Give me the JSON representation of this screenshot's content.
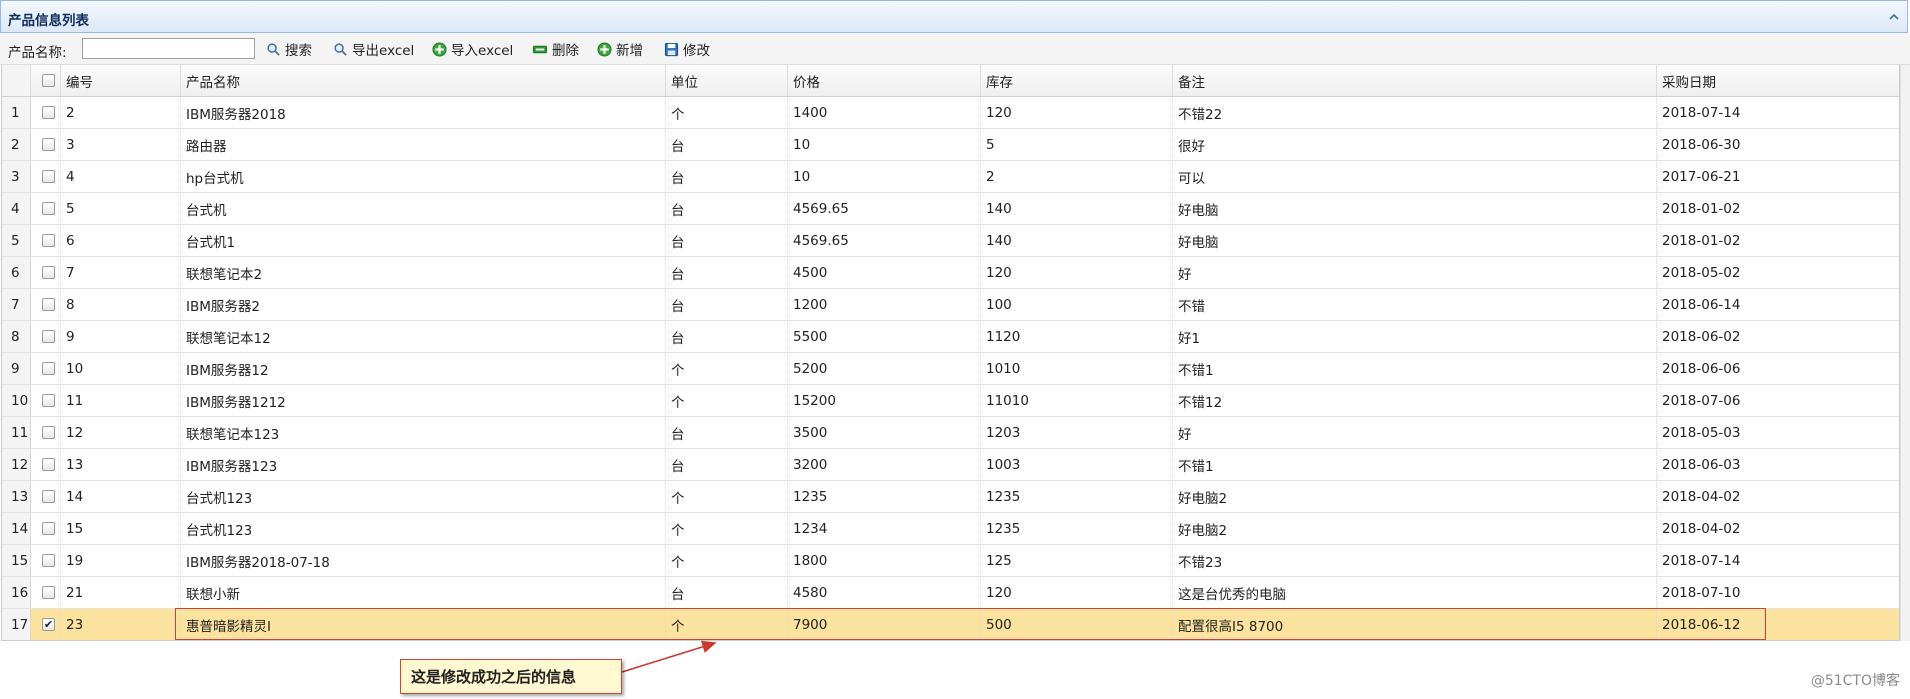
{
  "panel": {
    "title": "产品信息列表"
  },
  "toolbar": {
    "search_label": "产品名称:",
    "search_value": "",
    "buttons": [
      {
        "label": "搜索",
        "icon": "search-icon"
      },
      {
        "label": "导出excel",
        "icon": "search-icon"
      },
      {
        "label": "导入excel",
        "icon": "plus-circle-icon"
      },
      {
        "label": "删除",
        "icon": "minus-icon"
      },
      {
        "label": "新增",
        "icon": "plus-circle-icon"
      },
      {
        "label": "修改",
        "icon": "save-icon"
      }
    ]
  },
  "grid": {
    "columns": [
      "编号",
      "产品名称",
      "单位",
      "价格",
      "库存",
      "备注",
      "采购日期"
    ],
    "rows": [
      {
        "num": "1",
        "checked": false,
        "id": "2",
        "name": "IBM服务器2018",
        "unit": "个",
        "price": "1400",
        "stock": "120",
        "remark": "不错22",
        "date": "2018-07-14"
      },
      {
        "num": "2",
        "checked": false,
        "id": "3",
        "name": "路由器",
        "unit": "台",
        "price": "10",
        "stock": "5",
        "remark": "很好",
        "date": "2018-06-30"
      },
      {
        "num": "3",
        "checked": false,
        "id": "4",
        "name": "hp台式机",
        "unit": "台",
        "price": "10",
        "stock": "2",
        "remark": "可以",
        "date": "2017-06-21"
      },
      {
        "num": "4",
        "checked": false,
        "id": "5",
        "name": "台式机",
        "unit": "台",
        "price": "4569.65",
        "stock": "140",
        "remark": "好电脑",
        "date": "2018-01-02"
      },
      {
        "num": "5",
        "checked": false,
        "id": "6",
        "name": "台式机1",
        "unit": "台",
        "price": "4569.65",
        "stock": "140",
        "remark": "好电脑",
        "date": "2018-01-02"
      },
      {
        "num": "6",
        "checked": false,
        "id": "7",
        "name": "联想笔记本2",
        "unit": "台",
        "price": "4500",
        "stock": "120",
        "remark": "好",
        "date": "2018-05-02"
      },
      {
        "num": "7",
        "checked": false,
        "id": "8",
        "name": "IBM服务器2",
        "unit": "台",
        "price": "1200",
        "stock": "100",
        "remark": "不错",
        "date": "2018-06-14"
      },
      {
        "num": "8",
        "checked": false,
        "id": "9",
        "name": "联想笔记本12",
        "unit": "台",
        "price": "5500",
        "stock": "1120",
        "remark": "好1",
        "date": "2018-06-02"
      },
      {
        "num": "9",
        "checked": false,
        "id": "10",
        "name": "IBM服务器12",
        "unit": "个",
        "price": "5200",
        "stock": "1010",
        "remark": "不错1",
        "date": "2018-06-06"
      },
      {
        "num": "10",
        "checked": false,
        "id": "11",
        "name": "IBM服务器1212",
        "unit": "个",
        "price": "15200",
        "stock": "11010",
        "remark": "不错12",
        "date": "2018-07-06"
      },
      {
        "num": "11",
        "checked": false,
        "id": "12",
        "name": "联想笔记本123",
        "unit": "台",
        "price": "3500",
        "stock": "1203",
        "remark": "好",
        "date": "2018-05-03"
      },
      {
        "num": "12",
        "checked": false,
        "id": "13",
        "name": "IBM服务器123",
        "unit": "台",
        "price": "3200",
        "stock": "1003",
        "remark": "不错1",
        "date": "2018-06-03"
      },
      {
        "num": "13",
        "checked": false,
        "id": "14",
        "name": "台式机123",
        "unit": "个",
        "price": "1235",
        "stock": "1235",
        "remark": "好电脑2",
        "date": "2018-04-02"
      },
      {
        "num": "14",
        "checked": false,
        "id": "15",
        "name": "台式机123",
        "unit": "个",
        "price": "1234",
        "stock": "1235",
        "remark": "好电脑2",
        "date": "2018-04-02"
      },
      {
        "num": "15",
        "checked": false,
        "id": "19",
        "name": "IBM服务器2018-07-18",
        "unit": "个",
        "price": "1800",
        "stock": "125",
        "remark": "不错23",
        "date": "2018-07-14"
      },
      {
        "num": "16",
        "checked": false,
        "id": "21",
        "name": "联想小新",
        "unit": "台",
        "price": "4580",
        "stock": "120",
        "remark": "这是台优秀的电脑",
        "date": "2018-07-10"
      },
      {
        "num": "17",
        "checked": true,
        "id": "23",
        "name": "惠普暗影精灵I",
        "unit": "个",
        "price": "7900",
        "stock": "500",
        "remark": "配置很高I5 8700",
        "date": "2018-06-12"
      }
    ]
  },
  "annotation": {
    "text": "这是修改成功之后的信息"
  },
  "watermark": "@51CTO博客",
  "colors": {
    "selected_row": "#fbe29e",
    "highlight_border": "#d04040",
    "callout_bg": "#fff8d0"
  }
}
